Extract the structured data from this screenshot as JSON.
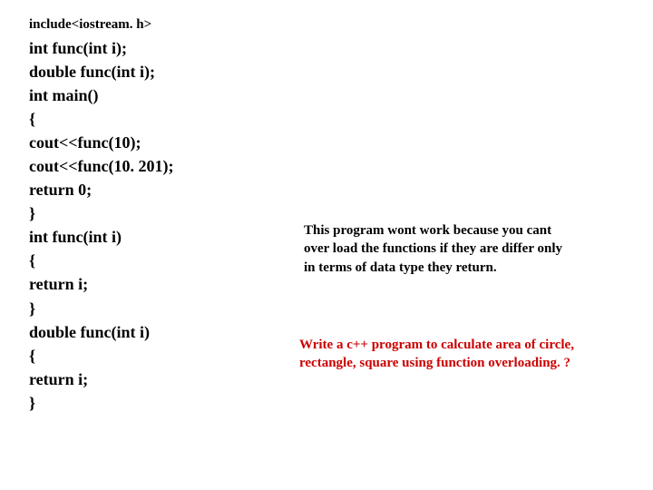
{
  "code": {
    "include": "include<iostream. h>",
    "l1": " int func(int i);",
    "l2": "double func(int i);",
    "l3": "int main()",
    "l4": "{",
    "l5": "cout<<func(10);",
    "l6": " cout<<func(10. 201);",
    "l7": " return 0;",
    "l8": "}",
    "l9": " int func(int i)",
    "l10": "{",
    "l11": " return i;",
    "l12": " }",
    "l13": " double func(int i)",
    "l14": " {",
    "l15": "return i;",
    "l16": " }"
  },
  "note": {
    "line1": "This program wont work because you cant",
    "line2": "  over load the functions if they are differ only",
    "line3": "  in terms of data type they return."
  },
  "question": {
    "line1": "Write a c++ program to calculate area of circle,",
    "line2": " rectangle, square using function overloading. ?"
  }
}
